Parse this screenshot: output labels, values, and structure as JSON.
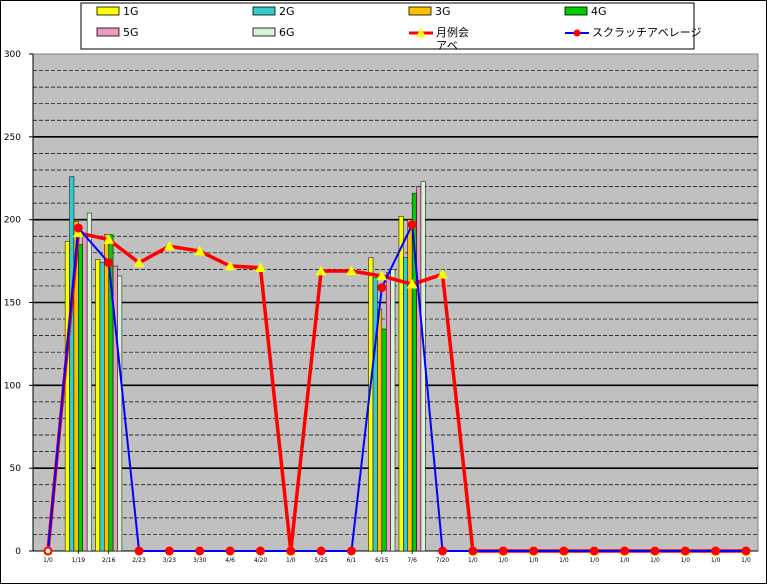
{
  "chart_data": {
    "type": "bar",
    "categories": [
      "1/0",
      "1/19",
      "2/16",
      "2/23",
      "3/23",
      "3/30",
      "4/6",
      "4/20",
      "1/0",
      "5/25",
      "6/1",
      "6/15",
      "7/6",
      "7/20",
      "1/0",
      "1/0",
      "1/0",
      "1/0",
      "1/0",
      "1/0",
      "1/0",
      "1/0",
      "1/0",
      "1/0"
    ],
    "ylim": [
      0,
      300
    ],
    "yticks": [
      "0",
      "50",
      "100",
      "150",
      "200",
      "250",
      "300"
    ],
    "grid": true,
    "legend_position": "top",
    "bar_series": [
      {
        "name": "1G",
        "color": "#FFFF00",
        "values": [
          0,
          187,
          176,
          0,
          0,
          0,
          0,
          0,
          0,
          0,
          0,
          177,
          202,
          0,
          0,
          0,
          0,
          0,
          0,
          0,
          0,
          0,
          0,
          0
        ]
      },
      {
        "name": "2G",
        "color": "#33CCCC",
        "values": [
          0,
          226,
          174,
          0,
          0,
          0,
          0,
          0,
          0,
          0,
          0,
          165,
          177,
          0,
          0,
          0,
          0,
          0,
          0,
          0,
          0,
          0,
          0,
          0
        ]
      },
      {
        "name": "3G",
        "color": "#FFC000",
        "values": [
          0,
          199,
          191,
          0,
          0,
          0,
          0,
          0,
          0,
          0,
          0,
          146,
          200,
          0,
          0,
          0,
          0,
          0,
          0,
          0,
          0,
          0,
          0,
          0
        ]
      },
      {
        "name": "4G",
        "color": "#00CC00",
        "values": [
          0,
          185,
          191,
          0,
          0,
          0,
          0,
          0,
          0,
          0,
          0,
          134,
          216,
          0,
          0,
          0,
          0,
          0,
          0,
          0,
          0,
          0,
          0,
          0
        ]
      },
      {
        "name": "5G",
        "color": "#E89AC0",
        "values": [
          0,
          190,
          172,
          0,
          0,
          0,
          0,
          0,
          0,
          0,
          0,
          168,
          220,
          0,
          0,
          0,
          0,
          0,
          0,
          0,
          0,
          0,
          0,
          0
        ]
      },
      {
        "name": "6G",
        "color": "#D8F2D8",
        "values": [
          0,
          204,
          166,
          0,
          0,
          0,
          0,
          0,
          0,
          0,
          0,
          170,
          223,
          0,
          0,
          0,
          0,
          0,
          0,
          0,
          0,
          0,
          0,
          0
        ]
      }
    ],
    "line_series": [
      {
        "name": "月例会アベ",
        "color": "#FF0000",
        "marker": "triangle",
        "marker_color": "#FFFF00",
        "values": [
          0,
          192,
          188,
          174,
          184,
          181,
          172,
          171,
          0,
          169,
          169,
          166,
          161,
          167,
          0,
          0,
          0,
          0,
          0,
          0,
          0,
          0,
          0,
          0
        ]
      },
      {
        "name": "スクラッチアベレージ",
        "color": "#0000FF",
        "marker": "circle",
        "marker_color": "#FF0000",
        "values": [
          0,
          195,
          174,
          0,
          0,
          0,
          0,
          0,
          0,
          0,
          0,
          159,
          197,
          0,
          0,
          0,
          0,
          0,
          0,
          0,
          0,
          0,
          0,
          0
        ]
      }
    ]
  },
  "legend": {
    "items": [
      "1G",
      "2G",
      "3G",
      "4G",
      "5G",
      "6G",
      "月例会アベ",
      "スクラッチアベレージ"
    ],
    "line1_wrap": "月例会",
    "line1_wrap2": "アベ"
  }
}
